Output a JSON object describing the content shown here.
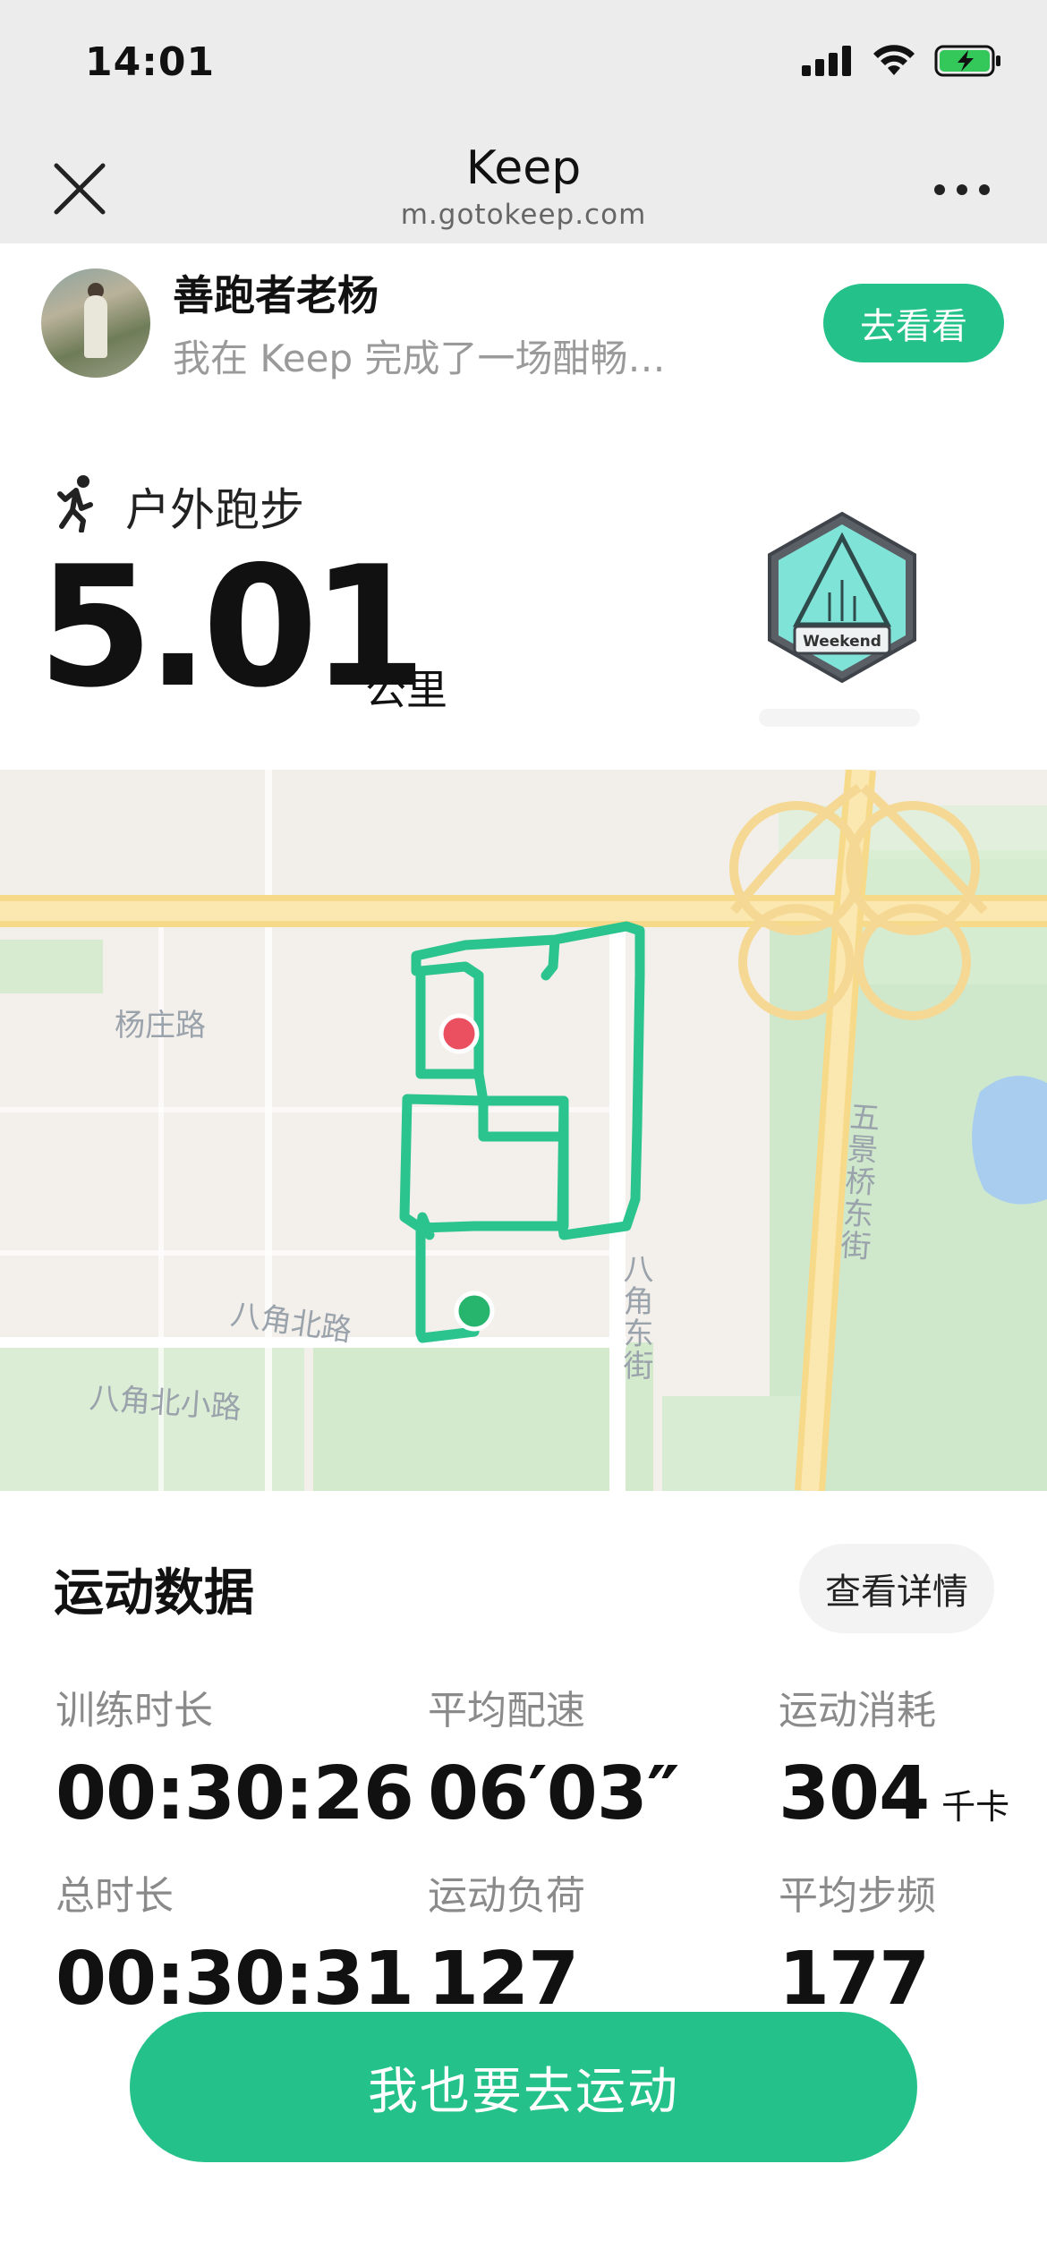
{
  "status_bar": {
    "time": "14:01"
  },
  "nav": {
    "title": "Keep",
    "domain": "m.gotokeep.com"
  },
  "banner": {
    "user_name": "善跑者老杨",
    "description": "我在 Keep 完成了一场酣畅…",
    "button_label": "去看看"
  },
  "activity": {
    "type": "户外跑步",
    "distance": "5.01",
    "unit": "公里",
    "medal_text": "Weekend"
  },
  "map": {
    "labels": {
      "yangzhuang_road": "杨庄路",
      "bajiao_north_road": "八角北路",
      "bajiao_north_small_road": "八角北小路",
      "bajiao_east_street": "八角东街",
      "wujingqiao_east_street": "五景桥东街"
    },
    "route_color": "#2bc48f",
    "start_color": "#27b56e",
    "end_color": "#ea5060"
  },
  "stats": {
    "title": "运动数据",
    "detail_button": "查看详情",
    "items": [
      {
        "label": "训练时长",
        "value": "00:30:26",
        "unit": ""
      },
      {
        "label": "平均配速",
        "value": "06′03″",
        "unit": ""
      },
      {
        "label": "运动消耗",
        "value": "304",
        "unit": "千卡"
      },
      {
        "label": "总时长",
        "value": "00:30:31",
        "unit": ""
      },
      {
        "label": "运动负荷",
        "value": "127",
        "unit": ""
      },
      {
        "label": "平均步频",
        "value": "177",
        "unit": ""
      }
    ]
  },
  "cta": {
    "label": "我也要去运动"
  },
  "colors": {
    "accent": "#24c28a",
    "nav_bg": "#ececec",
    "map_bg": "#f2efea"
  }
}
